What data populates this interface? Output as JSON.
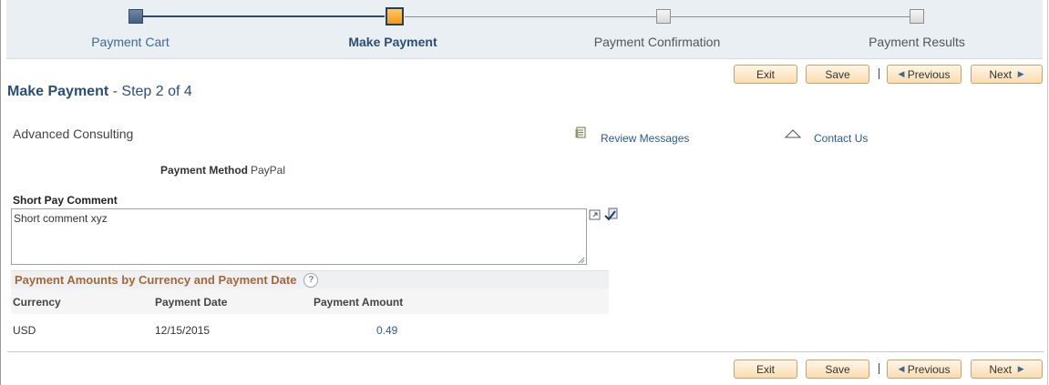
{
  "train": {
    "steps": [
      {
        "label": "Payment Cart",
        "state": "done"
      },
      {
        "label": "Make Payment",
        "state": "current"
      },
      {
        "label": "Payment Confirmation",
        "state": "todo"
      },
      {
        "label": "Payment Results",
        "state": "todo"
      }
    ]
  },
  "toolbar": {
    "exit_label": "Exit",
    "save_label": "Save",
    "previous_label": "Previous",
    "next_label": "Next"
  },
  "header": {
    "title": "Make Payment",
    "step_text": "- Step 2 of 4"
  },
  "company_name": "Advanced Consulting",
  "links": {
    "review_messages": "Review Messages",
    "contact_us": "Contact Us"
  },
  "payment_method": {
    "label": "Payment Method",
    "value": "PayPal"
  },
  "short_pay_comment": {
    "label": "Short Pay Comment",
    "value": "Short comment xyz"
  },
  "amounts_grid": {
    "title": "Payment Amounts by Currency and Payment Date",
    "help_glyph": "?",
    "columns": [
      "Currency",
      "Payment Date",
      "Payment Amount"
    ],
    "rows": [
      {
        "currency": "USD",
        "payment_date": "12/15/2015",
        "payment_amount": "0.49"
      }
    ]
  },
  "colors": {
    "accent_blue": "#2a4f77",
    "link_blue": "#2a5a8c",
    "current_step": "#f7a92e",
    "grid_title": "#a5673a",
    "button_fill": "#f9dcb0"
  }
}
